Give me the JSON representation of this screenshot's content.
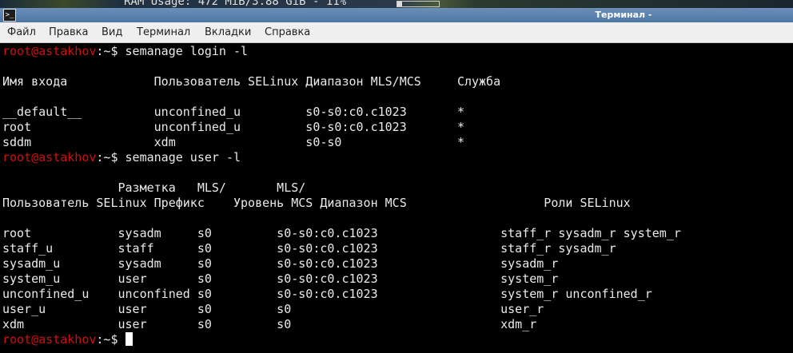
{
  "top_panel": {
    "ram_label": "RAM Usage: 472 MiB/3.88 GiB - 11%",
    "ram_fraction": 0.11
  },
  "window": {
    "icon_glyph": ">_",
    "title": "Терминал -"
  },
  "menu": {
    "items": [
      "Файл",
      "Правка",
      "Вид",
      "Терминал",
      "Вкладки",
      "Справка"
    ]
  },
  "terminal": {
    "prompt_user": "root@astakhov",
    "prompt_path": ":~$ ",
    "lines": [
      {
        "type": "prompt",
        "command": "semanage login -l"
      },
      {
        "type": "text",
        "text": ""
      },
      {
        "type": "text",
        "text": "Имя входа            Пользователь SELinux Диапазон MLS/MCS     Служба"
      },
      {
        "type": "text",
        "text": ""
      },
      {
        "type": "text",
        "text": "__default__          unconfined_u         s0-s0:c0.c1023       *"
      },
      {
        "type": "text",
        "text": "root                 unconfined_u         s0-s0:c0.c1023       *"
      },
      {
        "type": "text",
        "text": "sddm                 xdm                  s0-s0                *"
      },
      {
        "type": "prompt",
        "command": "semanage user -l"
      },
      {
        "type": "text",
        "text": ""
      },
      {
        "type": "text",
        "text": "                Разметка   MLS/       MLS/"
      },
      {
        "type": "text",
        "text": "Пользователь SELinux Префикс    Уровень MCS Диапазон MCS                   Роли SELinux"
      },
      {
        "type": "text",
        "text": ""
      },
      {
        "type": "text",
        "text": "root            sysadm     s0         s0-s0:c0.c1023                 staff_r sysadm_r system_r"
      },
      {
        "type": "text",
        "text": "staff_u         staff      s0         s0-s0:c0.c1023                 staff_r sysadm_r"
      },
      {
        "type": "text",
        "text": "sysadm_u        sysadm     s0         s0-s0:c0.c1023                 sysadm_r"
      },
      {
        "type": "text",
        "text": "system_u        user       s0         s0-s0:c0.c1023                 system_r"
      },
      {
        "type": "text",
        "text": "unconfined_u    unconfined s0         s0-s0:c0.c1023                 system_r unconfined_r"
      },
      {
        "type": "text",
        "text": "user_u          user       s0         s0                             user_r"
      },
      {
        "type": "text",
        "text": "xdm             user       s0         s0                             xdm_r"
      },
      {
        "type": "prompt",
        "command": "",
        "cursor": true
      }
    ]
  }
}
